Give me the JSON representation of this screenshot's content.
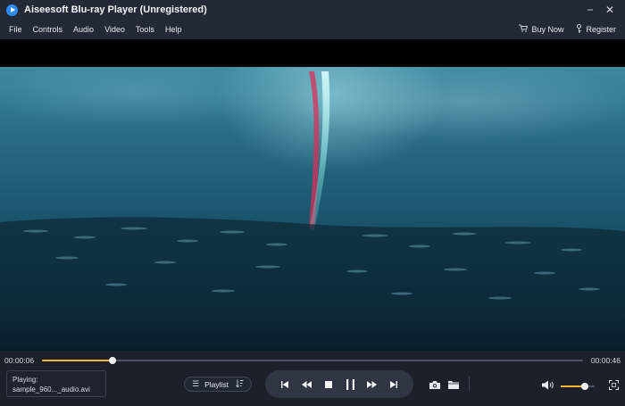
{
  "window": {
    "title": "Aiseesoft Blu-ray Player (Unregistered)",
    "minimize_glyph": "−",
    "close_glyph": "✕"
  },
  "menu": {
    "items": [
      "File",
      "Controls",
      "Audio",
      "Video",
      "Tools",
      "Help"
    ],
    "buy_now": "Buy Now",
    "register": "Register"
  },
  "playback": {
    "elapsed": "00:00:06",
    "total": "00:00:46",
    "progress": 0.13
  },
  "now_playing": {
    "label": "Playing:",
    "file": "sample_960..._audio.avi"
  },
  "playlist": {
    "label": "Playlist"
  },
  "volume": {
    "level": 0.7
  },
  "colors": {
    "accent": "#f2b23a",
    "background": "#1b2029",
    "titlebar": "#232936"
  },
  "icons": {
    "app": "play-logo-icon",
    "buy": "cart-icon",
    "register": "key-icon",
    "playlist": "list-icon",
    "sort": "sort-icon",
    "previous": "skip-previous-icon",
    "rewind": "rewind-icon",
    "stop": "stop-icon",
    "pause": "pause-icon",
    "forward": "fast-forward-icon",
    "next": "skip-next-icon",
    "snapshot": "camera-icon",
    "open": "folder-icon",
    "volume": "speaker-icon",
    "fullscreen": "fullscreen-icon"
  }
}
